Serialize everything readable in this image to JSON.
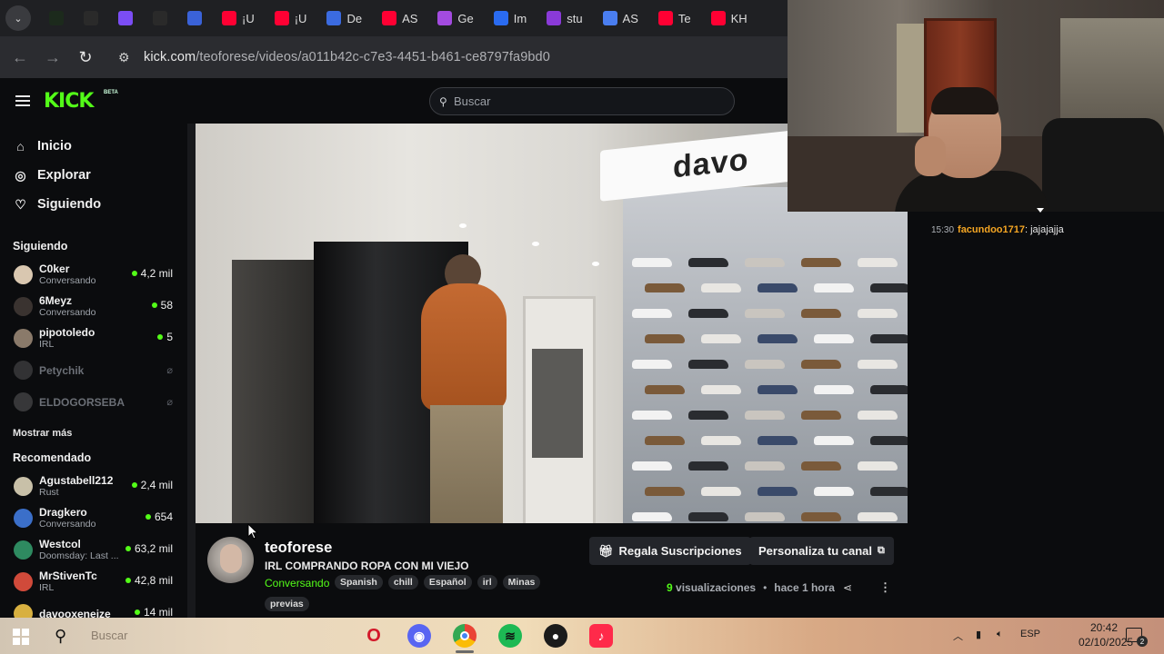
{
  "browser": {
    "tabs": [
      {
        "label": "",
        "icon": "kick-icon",
        "color": "#1c2a1c"
      },
      {
        "label": "",
        "icon": "openai-icon",
        "color": "#2a2a2a"
      },
      {
        "label": "",
        "icon": "s-app-icon",
        "color": "#7b4df5"
      },
      {
        "label": "",
        "icon": "openai-icon",
        "color": "#2a2a2a"
      },
      {
        "label": "",
        "icon": "gemini-icon",
        "color": "#3a62d8"
      },
      {
        "label": "¡U",
        "icon": "youtube-icon",
        "color": "#ff0033"
      },
      {
        "label": "¡U",
        "icon": "youtube-icon",
        "color": "#ff0033"
      },
      {
        "label": "De",
        "icon": "arrow-icon",
        "color": "#3b6be0"
      },
      {
        "label": "AS",
        "icon": "youtube-icon",
        "color": "#ff0033"
      },
      {
        "label": "Ge",
        "icon": "gear-icon",
        "color": "#a34be0"
      },
      {
        "label": "Im",
        "icon": "w-icon",
        "color": "#2a6bf0"
      },
      {
        "label": "stu",
        "icon": "play-icon",
        "color": "#8a3ad8"
      },
      {
        "label": "AS",
        "icon": "docs-icon",
        "color": "#4a7ef0"
      },
      {
        "label": "Te",
        "icon": "youtube-icon",
        "color": "#ff0033"
      },
      {
        "label": "KH",
        "icon": "youtube-icon",
        "color": "#ff0033"
      }
    ],
    "url_host": "kick.com",
    "url_path": "/teoforese/videos/a011b42c-c7e3-4451-b461-ce8797fa9bd0"
  },
  "header": {
    "logo": "KICK",
    "beta": "BETA",
    "search_placeholder": "Buscar"
  },
  "sidebar": {
    "nav": [
      {
        "label": "Inicio",
        "icon": "home-icon"
      },
      {
        "label": "Explorar",
        "icon": "compass-icon"
      },
      {
        "label": "Siguiendo",
        "icon": "heart-icon"
      }
    ],
    "following_title": "Siguiendo",
    "following": [
      {
        "name": "C0ker",
        "category": "Conversando",
        "viewers": "4,2 mil",
        "live": true,
        "color": "#d9c7b0"
      },
      {
        "name": "6Meyz",
        "category": "Conversando",
        "viewers": "58",
        "live": true,
        "color": "#3a3330"
      },
      {
        "name": "pipotoledo",
        "category": "IRL",
        "viewers": "5",
        "live": true,
        "color": "#8a7a6a"
      },
      {
        "name": "Petychik",
        "category": "",
        "viewers": "",
        "live": false,
        "color": "#7a7a7a"
      },
      {
        "name": "ELDOGORSEBA",
        "category": "",
        "viewers": "",
        "live": false,
        "color": "#8a8a8a"
      }
    ],
    "show_more": "Mostrar más",
    "recommended_title": "Recomendado",
    "recommended": [
      {
        "name": "Agustabell212",
        "category": "Rust",
        "viewers": "2,4 mil",
        "color": "#c8c0a8"
      },
      {
        "name": "Dragkero",
        "category": "Conversando",
        "viewers": "654",
        "color": "#3b6fc9"
      },
      {
        "name": "Westcol",
        "category": "Doomsday: Last ...",
        "viewers": "63,2 mil",
        "color": "#2e8a60"
      },
      {
        "name": "MrStivenTc",
        "category": "IRL",
        "viewers": "42,8 mil",
        "color": "#d04a3a"
      },
      {
        "name": "davooxeneize",
        "category": "",
        "viewers": "14 mil",
        "color": "#d8b040"
      }
    ]
  },
  "video": {
    "sign_text": "davo"
  },
  "chat": {
    "time": "15:30",
    "user": "facundoo1717",
    "message": ": jajajajja"
  },
  "channel": {
    "name": "teoforese",
    "title": "IRL COMPRANDO ROPA CON MI VIEJO",
    "category": "Conversando",
    "tags": [
      "Spanish",
      "chill",
      "Español",
      "irl",
      "Minas"
    ],
    "extra_tag": "previas",
    "gift_button": "Regala Suscripciones",
    "customize_button": "Personaliza tu canal",
    "views_count": "9",
    "views_label": "visualizaciones",
    "age": "hace 1 hora"
  },
  "taskbar": {
    "search_placeholder": "Buscar",
    "lang": "ESP",
    "time": "20:42",
    "date": "02/10/2025",
    "notifications": "2"
  }
}
